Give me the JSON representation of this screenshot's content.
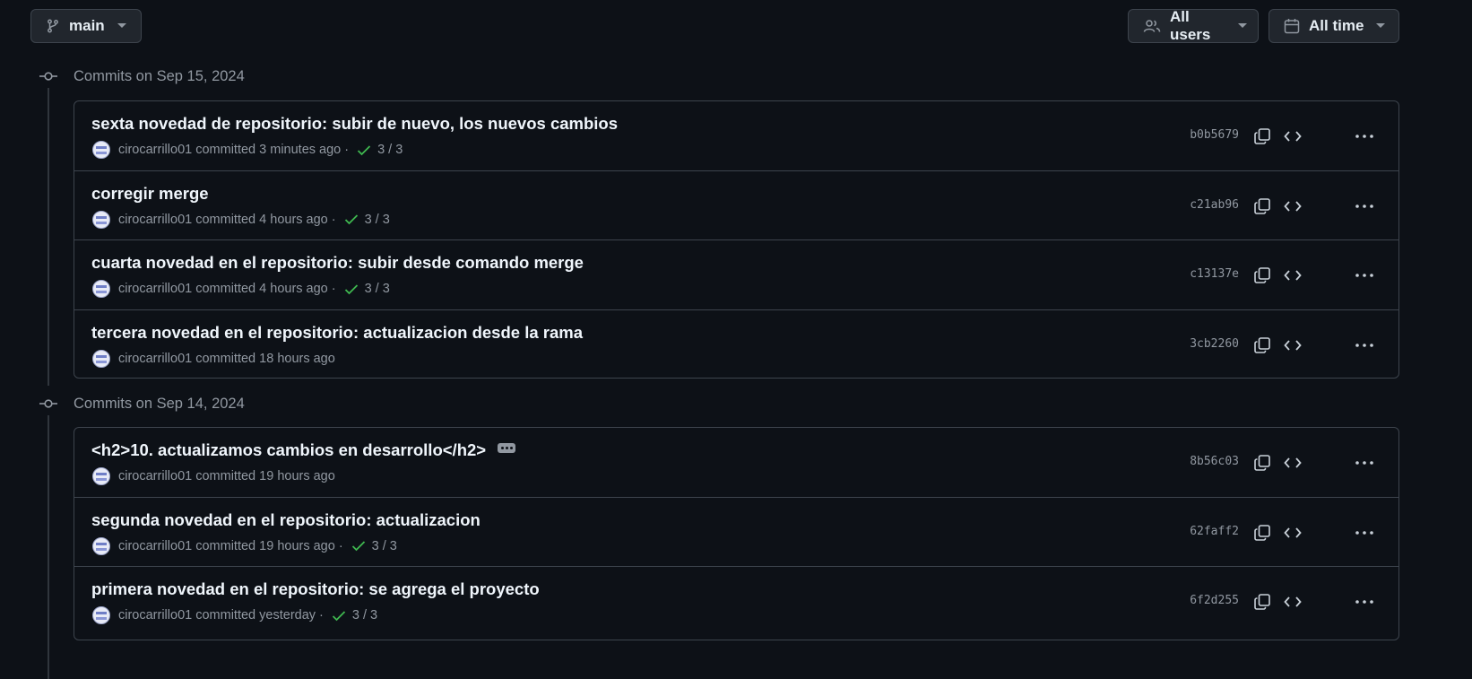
{
  "filters": {
    "branch": "main",
    "users": "All users",
    "time": "All time"
  },
  "groups": [
    {
      "date_label": "Commits on Sep 15, 2024",
      "commits": [
        {
          "title": "sexta novedad de repositorio: subir de nuevo, los nuevos cambios",
          "author": "cirocarrillo01",
          "action": "committed",
          "time": "3 minutes ago",
          "checks": "3 / 3",
          "sha": "b0b5679"
        },
        {
          "title": "corregir merge",
          "author": "cirocarrillo01",
          "action": "committed",
          "time": "4 hours ago",
          "checks": "3 / 3",
          "sha": "c21ab96"
        },
        {
          "title": "cuarta novedad en el repositorio: subir desde comando merge",
          "author": "cirocarrillo01",
          "action": "committed",
          "time": "4 hours ago",
          "checks": "3 / 3",
          "sha": "c13137e"
        },
        {
          "title": "tercera novedad en el repositorio: actualizacion desde la rama",
          "author": "cirocarrillo01",
          "action": "committed",
          "time": "18 hours ago",
          "checks": null,
          "sha": "3cb2260"
        }
      ]
    },
    {
      "date_label": "Commits on Sep 14, 2024",
      "commits": [
        {
          "title": "<h2>10. actualizamos cambios en desarrollo</h2>",
          "author": "cirocarrillo01",
          "action": "committed",
          "time": "19 hours ago",
          "checks": null,
          "sha": "8b56c03",
          "has_more_message": true
        },
        {
          "title": "segunda novedad en el repositorio: actualizacion",
          "author": "cirocarrillo01",
          "action": "committed",
          "time": "19 hours ago",
          "checks": "3 / 3",
          "sha": "62faff2"
        },
        {
          "title": "primera novedad en el repositorio: se agrega el proyecto",
          "author": "cirocarrillo01",
          "action": "committed",
          "time": "yesterday",
          "checks": "3 / 3",
          "sha": "6f2d255"
        }
      ]
    }
  ],
  "icons": {
    "branch": "git-branch-icon",
    "users": "people-icon",
    "time": "calendar-icon",
    "caret": "triangle-down-icon",
    "commit": "git-commit-icon",
    "check": "check-icon",
    "copy": "copy-icon",
    "browse": "code-icon",
    "more": "kebab-horizontal-icon"
  },
  "colors": {
    "background": "#0d1117",
    "border": "#3d444d",
    "button_bg": "#21262d",
    "text_primary": "#f0f6fc",
    "text_muted": "#9198a1",
    "success": "#3fb950"
  }
}
